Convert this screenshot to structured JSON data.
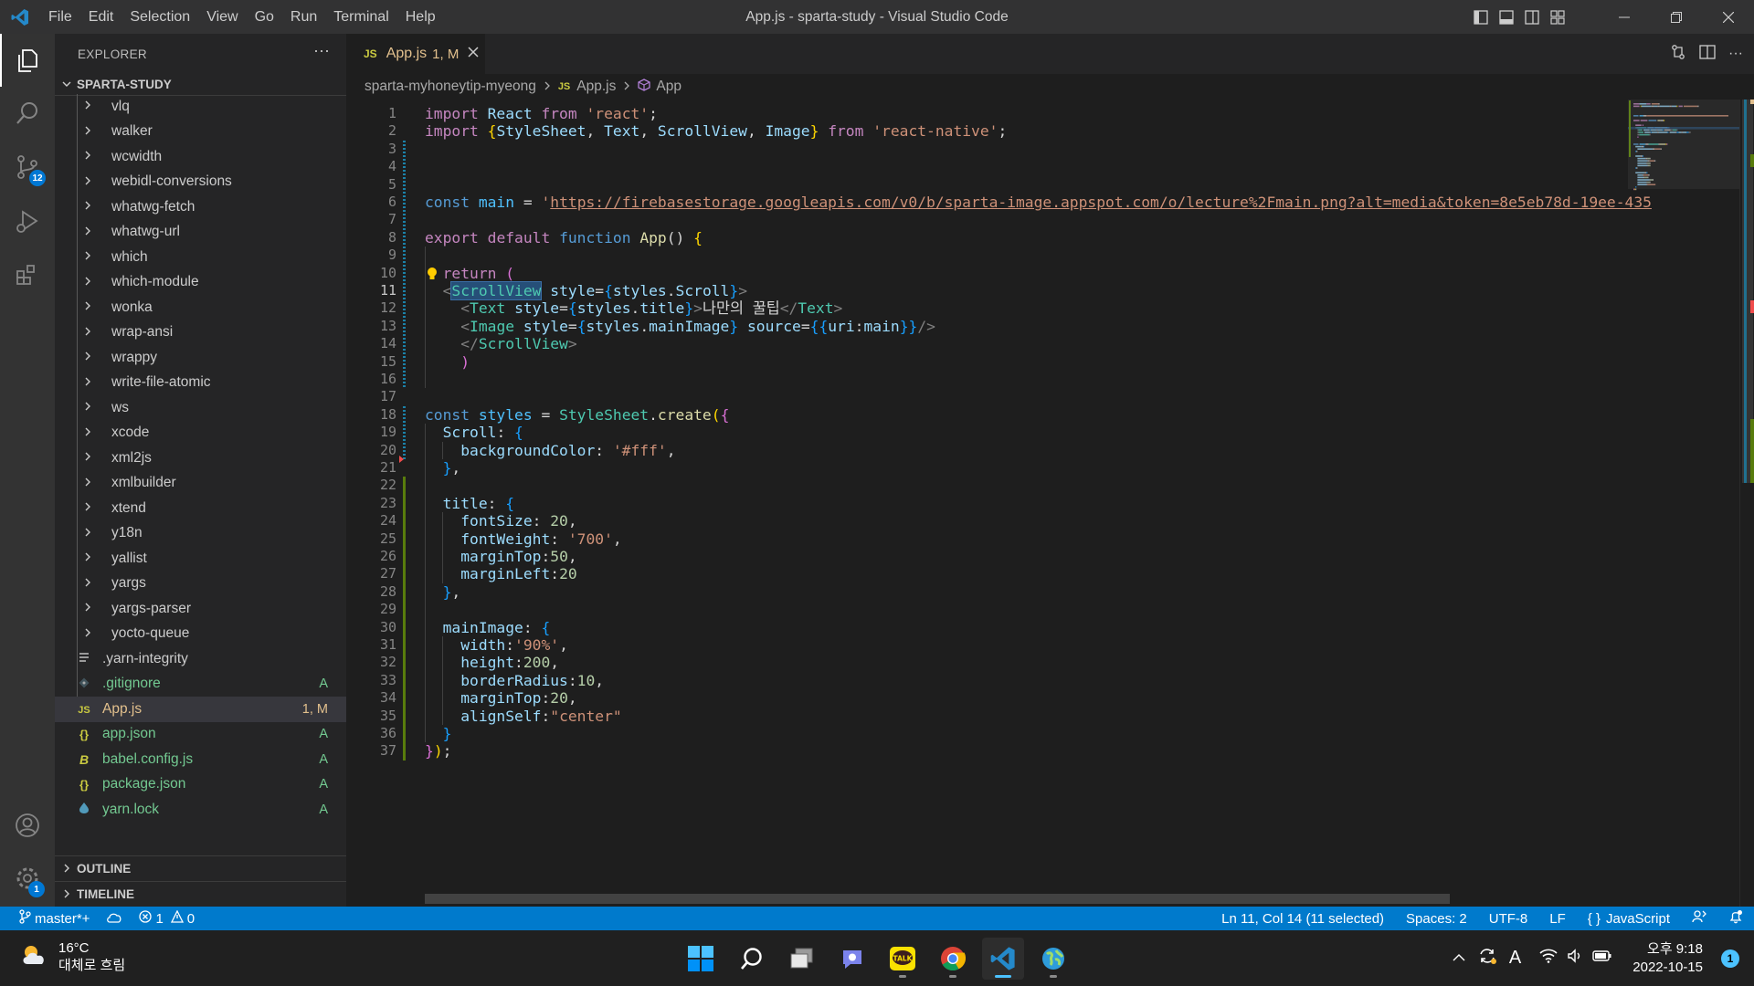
{
  "titlebar": {
    "menu": [
      "File",
      "Edit",
      "Selection",
      "View",
      "Go",
      "Run",
      "Terminal",
      "Help"
    ],
    "title": "App.js - sparta-study - Visual Studio Code"
  },
  "activitybar": {
    "scm_badge": "12",
    "settings_badge": "1"
  },
  "sidebar": {
    "header": "EXPLORER",
    "root": "SPARTA-STUDY",
    "folders": [
      "vlq",
      "walker",
      "wcwidth",
      "webidl-conversions",
      "whatwg-fetch",
      "whatwg-url",
      "which",
      "which-module",
      "wonka",
      "wrap-ansi",
      "wrappy",
      "write-file-atomic",
      "ws",
      "xcode",
      "xml2js",
      "xmlbuilder",
      "xtend",
      "y18n",
      "yallist",
      "yargs",
      "yargs-parser",
      "yocto-queue"
    ],
    "files": [
      {
        "name": ".yarn-integrity",
        "status": "",
        "icon": "lines-icon"
      },
      {
        "name": ".gitignore",
        "status": "A",
        "icon": "git-icon"
      },
      {
        "name": "App.js",
        "status": "1, M",
        "icon": "js-icon"
      },
      {
        "name": "app.json",
        "status": "A",
        "icon": "json-icon"
      },
      {
        "name": "babel.config.js",
        "status": "A",
        "icon": "babel-icon"
      },
      {
        "name": "package.json",
        "status": "A",
        "icon": "json-icon"
      },
      {
        "name": "yarn.lock",
        "status": "A",
        "icon": "yarn-icon"
      }
    ],
    "outline": "OUTLINE",
    "timeline": "TIMELINE"
  },
  "editor": {
    "tab": {
      "label": "App.js",
      "badge": "1, M",
      "icon_text": "JS"
    },
    "breadcrumb": [
      "sparta-myhoneytip-myeong",
      "App.js",
      "App"
    ],
    "breadcrumb_js": "JS",
    "lines": [
      [
        [
          "import",
          "kw"
        ],
        [
          " React ",
          "var"
        ],
        [
          "from",
          "kw"
        ],
        [
          " ",
          "p"
        ],
        [
          "'react'",
          "str"
        ],
        [
          ";",
          "p"
        ]
      ],
      [
        [
          "import",
          "kw"
        ],
        [
          " ",
          "p"
        ],
        [
          "{",
          "br"
        ],
        [
          "StyleSheet",
          "var"
        ],
        [
          ", ",
          "p"
        ],
        [
          "Text",
          "var"
        ],
        [
          ", ",
          "p"
        ],
        [
          "ScrollView",
          "var"
        ],
        [
          ", ",
          "p"
        ],
        [
          "Image",
          "var"
        ],
        [
          "}",
          "br"
        ],
        [
          " ",
          "p"
        ],
        [
          "from",
          "kw"
        ],
        [
          " ",
          "p"
        ],
        [
          "'react-native'",
          "str"
        ],
        [
          ";",
          "p"
        ]
      ],
      [],
      [],
      [],
      [
        [
          "const",
          "blue"
        ],
        [
          " ",
          "p"
        ],
        [
          "main",
          "const"
        ],
        [
          " = ",
          "p"
        ],
        [
          "'",
          "str"
        ],
        [
          "https://firebasestorage.googleapis.com/v0/b/sparta-image.appspot.com/o/lecture%2Fmain.png?alt=media&token=8e5eb78d-19ee-435",
          "url"
        ]
      ],
      [],
      [
        [
          "export",
          "kw"
        ],
        [
          " ",
          "p"
        ],
        [
          "default",
          "kw"
        ],
        [
          " ",
          "p"
        ],
        [
          "function",
          "blue"
        ],
        [
          " ",
          "p"
        ],
        [
          "App",
          "fn"
        ],
        [
          "() ",
          "p"
        ],
        [
          "{",
          "br"
        ]
      ],
      [],
      [
        [
          "  ",
          "p"
        ],
        [
          "return",
          "kw"
        ],
        [
          " ",
          "p"
        ],
        [
          "(",
          "br2"
        ]
      ],
      [
        [
          "  ",
          "p"
        ],
        [
          "<",
          "tagp"
        ],
        [
          "ScrollView",
          "tagsel"
        ],
        [
          " ",
          "p"
        ],
        [
          "style",
          "attr"
        ],
        [
          "=",
          "p"
        ],
        [
          "{",
          "br3"
        ],
        [
          "styles",
          "var"
        ],
        [
          ".",
          "p"
        ],
        [
          "Scroll",
          "var"
        ],
        [
          "}",
          "br3"
        ],
        [
          ">",
          "tagp"
        ]
      ],
      [
        [
          "    ",
          "p"
        ],
        [
          "<",
          "tagp"
        ],
        [
          "Text",
          "tag"
        ],
        [
          " ",
          "p"
        ],
        [
          "style",
          "attr"
        ],
        [
          "=",
          "p"
        ],
        [
          "{",
          "br3"
        ],
        [
          "styles",
          "var"
        ],
        [
          ".",
          "p"
        ],
        [
          "title",
          "var"
        ],
        [
          "}",
          "br3"
        ],
        [
          ">",
          "tagp"
        ],
        [
          "나만의 꿀팁",
          "p"
        ],
        [
          "</",
          "tagp"
        ],
        [
          "Text",
          "tag"
        ],
        [
          ">",
          "tagp"
        ]
      ],
      [
        [
          "    ",
          "p"
        ],
        [
          "<",
          "tagp"
        ],
        [
          "Image",
          "tag"
        ],
        [
          " ",
          "p"
        ],
        [
          "style",
          "attr"
        ],
        [
          "=",
          "p"
        ],
        [
          "{",
          "br3"
        ],
        [
          "styles",
          "var"
        ],
        [
          ".",
          "p"
        ],
        [
          "mainImage",
          "var"
        ],
        [
          "}",
          "br3"
        ],
        [
          " ",
          "p"
        ],
        [
          "source",
          "attr"
        ],
        [
          "=",
          "p"
        ],
        [
          "{{",
          "br3"
        ],
        [
          "uri",
          "var"
        ],
        [
          ":",
          "p"
        ],
        [
          "main",
          "var"
        ],
        [
          "}}",
          "br3"
        ],
        [
          "/>",
          "tagp"
        ]
      ],
      [
        [
          "    ",
          "p"
        ],
        [
          "</",
          "tagp"
        ],
        [
          "ScrollView",
          "tag"
        ],
        [
          ">",
          "tagp"
        ]
      ],
      [
        [
          "    ",
          "p"
        ],
        [
          ")",
          "br2"
        ]
      ],
      [],
      [],
      [
        [
          "const",
          "blue"
        ],
        [
          " ",
          "p"
        ],
        [
          "styles",
          "const"
        ],
        [
          " = ",
          "p"
        ],
        [
          "StyleSheet",
          "type"
        ],
        [
          ".",
          "p"
        ],
        [
          "create",
          "fn"
        ],
        [
          "(",
          "br"
        ],
        [
          "{",
          "br2"
        ]
      ],
      [
        [
          "  ",
          "p"
        ],
        [
          "Scroll",
          "var"
        ],
        [
          ": ",
          "p"
        ],
        [
          "{",
          "br3"
        ]
      ],
      [
        [
          "    ",
          "p"
        ],
        [
          "backgroundColor",
          "var"
        ],
        [
          ": ",
          "p"
        ],
        [
          "'#fff'",
          "str"
        ],
        [
          ",",
          "p"
        ]
      ],
      [
        [
          "  ",
          "p"
        ],
        [
          "}",
          "br3"
        ],
        [
          ",",
          "p"
        ]
      ],
      [],
      [
        [
          "  ",
          "p"
        ],
        [
          "title",
          "var"
        ],
        [
          ": ",
          "p"
        ],
        [
          "{",
          "br3"
        ]
      ],
      [
        [
          "    ",
          "p"
        ],
        [
          "fontSize",
          "var"
        ],
        [
          ": ",
          "p"
        ],
        [
          "20",
          "num"
        ],
        [
          ",",
          "p"
        ]
      ],
      [
        [
          "    ",
          "p"
        ],
        [
          "fontWeight",
          "var"
        ],
        [
          ": ",
          "p"
        ],
        [
          "'700'",
          "str"
        ],
        [
          ",",
          "p"
        ]
      ],
      [
        [
          "    ",
          "p"
        ],
        [
          "marginTop",
          "var"
        ],
        [
          ":",
          "p"
        ],
        [
          "50",
          "num"
        ],
        [
          ",",
          "p"
        ]
      ],
      [
        [
          "    ",
          "p"
        ],
        [
          "marginLeft",
          "var"
        ],
        [
          ":",
          "p"
        ],
        [
          "20",
          "num"
        ]
      ],
      [
        [
          "  ",
          "p"
        ],
        [
          "}",
          "br3"
        ],
        [
          ",",
          "p"
        ]
      ],
      [],
      [
        [
          "  ",
          "p"
        ],
        [
          "mainImage",
          "var"
        ],
        [
          ": ",
          "p"
        ],
        [
          "{",
          "br3"
        ]
      ],
      [
        [
          "    ",
          "p"
        ],
        [
          "width",
          "var"
        ],
        [
          ":",
          "p"
        ],
        [
          "'90%'",
          "str"
        ],
        [
          ",",
          "p"
        ]
      ],
      [
        [
          "    ",
          "p"
        ],
        [
          "height",
          "var"
        ],
        [
          ":",
          "p"
        ],
        [
          "200",
          "num"
        ],
        [
          ",",
          "p"
        ]
      ],
      [
        [
          "    ",
          "p"
        ],
        [
          "borderRadius",
          "var"
        ],
        [
          ":",
          "p"
        ],
        [
          "10",
          "num"
        ],
        [
          ",",
          "p"
        ]
      ],
      [
        [
          "    ",
          "p"
        ],
        [
          "marginTop",
          "var"
        ],
        [
          ":",
          "p"
        ],
        [
          "20",
          "num"
        ],
        [
          ",",
          "p"
        ]
      ],
      [
        [
          "    ",
          "p"
        ],
        [
          "alignSelf",
          "var"
        ],
        [
          ":",
          "p"
        ],
        [
          "\"center\"",
          "str"
        ]
      ],
      [
        [
          "  ",
          "p"
        ],
        [
          "}",
          "br3"
        ]
      ],
      [
        [
          "}",
          "br2"
        ],
        [
          ")",
          "br"
        ],
        [
          ";",
          "p"
        ]
      ]
    ],
    "active_line": 11
  },
  "statusbar": {
    "branch": "master*+",
    "errors": "1",
    "warnings": "0",
    "position": "Ln 11, Col 14 (11 selected)",
    "spaces": "Spaces: 2",
    "encoding": "UTF-8",
    "eol": "LF",
    "language": "JavaScript",
    "language_icon": "{ }"
  },
  "taskbar": {
    "temperature": "16°C",
    "weather": "대체로 흐림",
    "time": "오후 9:18",
    "date": "2022-10-15",
    "notification_count": "1",
    "ime": "A",
    "kakao_label": "TALK"
  },
  "colors": {
    "kw": "#c586c0",
    "blue": "#569cd6",
    "var": "#9cdcfe",
    "const": "#4fc1ff",
    "str": "#ce9178",
    "url": "#ce9178",
    "fn": "#dcdcaa",
    "type": "#4ec9b0",
    "num": "#b5cea8",
    "tag": "#4ec9b0",
    "tagsel": "#4ec9b0",
    "tagp": "#808080",
    "attr": "#9cdcfe",
    "br": "#ffd700",
    "br2": "#da70d6",
    "br3": "#179fff",
    "p": "#d4d4d4",
    "accent": "#007acc",
    "added": "#73c991",
    "modified": "#e2c08d"
  }
}
